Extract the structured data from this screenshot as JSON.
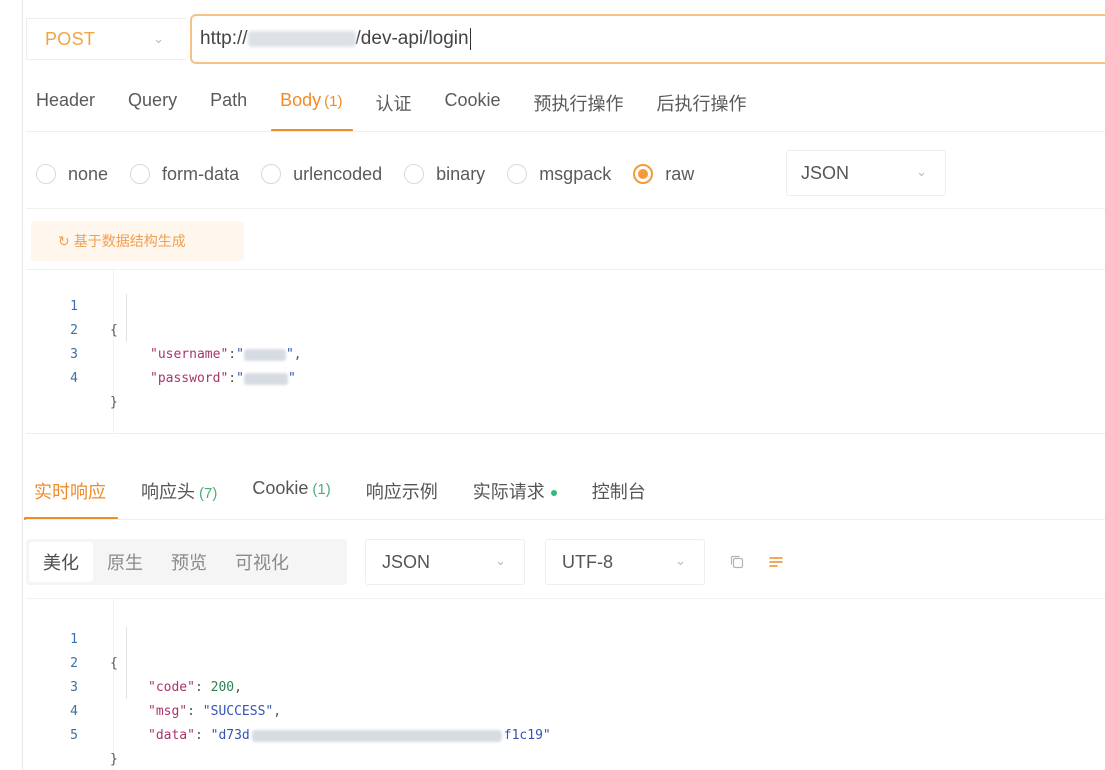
{
  "request": {
    "method": "POST",
    "url_prefix": "http://",
    "url_suffix": "/dev-api/login"
  },
  "request_tabs": [
    {
      "label": "Header"
    },
    {
      "label": "Query"
    },
    {
      "label": "Path"
    },
    {
      "label": "Body",
      "count": "(1)",
      "active": true
    },
    {
      "label": "认证"
    },
    {
      "label": "Cookie"
    },
    {
      "label": "预执行操作"
    },
    {
      "label": "后执行操作"
    }
  ],
  "body_types": {
    "options": [
      "none",
      "form-data",
      "urlencoded",
      "binary",
      "msgpack",
      "raw"
    ],
    "selected": "raw",
    "format": "JSON"
  },
  "generate_button": {
    "label": "基于数据结构生成",
    "icon": "refresh-icon"
  },
  "request_body": {
    "line_numbers": [
      "1",
      "2",
      "3",
      "4"
    ],
    "open_brace": "{",
    "close_brace": "}",
    "username_key": "\"username\"",
    "password_key": "\"password\"",
    "colon": ":",
    "comma": ",",
    "quote": "\""
  },
  "response_tabs": [
    {
      "label": "实时响应",
      "active": true
    },
    {
      "label": "响应头",
      "count": "(7)"
    },
    {
      "label": "Cookie",
      "count": "(1)"
    },
    {
      "label": "响应示例"
    },
    {
      "label": "实际请求",
      "dot": true
    },
    {
      "label": "控制台"
    }
  ],
  "response_view": {
    "modes": [
      "美化",
      "原生",
      "预览",
      "可视化"
    ],
    "active_mode": "美化",
    "format": "JSON",
    "encoding": "UTF-8",
    "icons": [
      "copy-icon",
      "wrap-lines-icon"
    ]
  },
  "response_body": {
    "line_numbers": [
      "1",
      "2",
      "3",
      "4",
      "5"
    ],
    "open_brace": "{",
    "close_brace": "}",
    "code_key": "\"code\"",
    "code_value": "200",
    "msg_key": "\"msg\"",
    "msg_value": "\"SUCCESS\"",
    "data_key": "\"data\"",
    "data_value_start": "\"d73d",
    "data_value_end": "f1c19\""
  },
  "colors": {
    "accent": "#f08c28",
    "method": "#f4a340",
    "success_dot": "#2ebd7a"
  }
}
